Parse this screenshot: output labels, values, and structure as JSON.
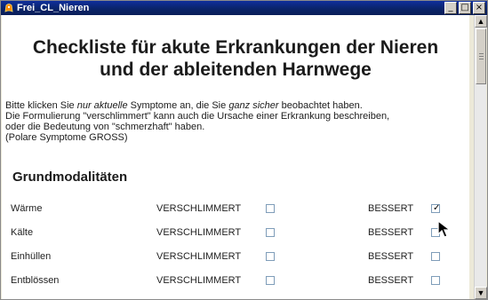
{
  "window": {
    "title": "Frei_CL_Nieren",
    "controls": [
      "_",
      "□",
      "×"
    ]
  },
  "page": {
    "heading_line_1": "Checkliste für akute Erkrankungen der Nieren",
    "heading_line_2": "und der ableitenden Harnwege",
    "intro": {
      "line_1_part_1": "Bitte klicken Sie ",
      "line_1_emphasis_1": "nur aktuelle",
      "line_1_part_2": " Symptome an, die Sie ",
      "line_1_emphasis_2": "ganz sicher",
      "line_1_part_3": " beobachtet haben.",
      "line_2": "Die Formulierung \"verschlimmert\" kann auch die Ursache einer Erkrankung beschreiben,",
      "line_3": "oder die Bedeutung von \"schmerzhaft\" haben.",
      "line_4": "(Polare Symptome GROSS)"
    },
    "section_title": "Grundmodalitäten",
    "rows": [
      {
        "name": "Wärme",
        "worse_label": "VERSCHLIMMERT",
        "better_label": "BESSERT",
        "worse_checked": false,
        "better_checked": true
      },
      {
        "name": "Kälte",
        "worse_label": "VERSCHLIMMERT",
        "better_label": "BESSERT",
        "worse_checked": false,
        "better_checked": false
      },
      {
        "name": "Einhüllen",
        "worse_label": "VERSCHLIMMERT",
        "better_label": "BESSERT",
        "worse_checked": false,
        "better_checked": false
      },
      {
        "name": "Entblössen",
        "worse_label": "VERSCHLIMMERT",
        "better_label": "BESSERT",
        "worse_checked": false,
        "better_checked": false
      }
    ]
  },
  "scrollbar": {
    "up_arrow": "▲",
    "down_arrow": "▼"
  },
  "icons": {
    "app": "app-icon",
    "checkmark": "✓"
  }
}
